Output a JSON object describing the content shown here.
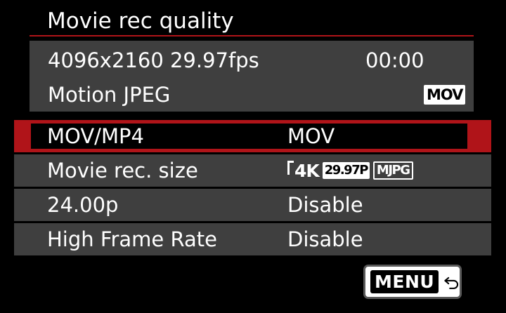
{
  "screen": {
    "title": "Movie rec quality"
  },
  "info": {
    "resolution_fps": "4096x2160 29.97fps",
    "recording_time": "00:00",
    "codec": "Motion JPEG",
    "format_badge": "MOV"
  },
  "menu_items": [
    {
      "label": "MOV/MP4",
      "value": "MOV",
      "selected": true
    },
    {
      "label": "Movie rec. size",
      "value": "",
      "icons": [
        "4K",
        "29.97P",
        "MJPG"
      ]
    },
    {
      "label": "24.00p",
      "value": "Disable"
    },
    {
      "label": "High Frame Rate",
      "value": "Disable"
    }
  ],
  "footer": {
    "menu_label": "MENU",
    "back_icon": "return-arrow-icon"
  },
  "colors": {
    "accent_red": "#b01419",
    "panel_gray": "#3f3f3f",
    "background": "#000000"
  }
}
